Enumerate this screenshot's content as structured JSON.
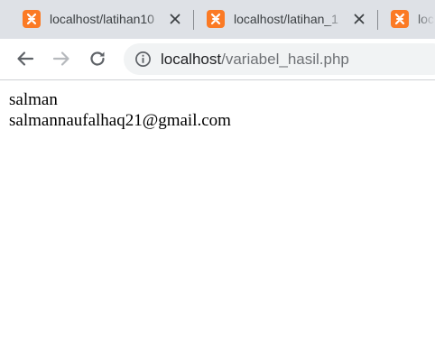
{
  "tabs": [
    {
      "title": "localhost/latihan10",
      "close_glyph": "✕",
      "active": false
    },
    {
      "title": "localhost/latihan_1",
      "close_glyph": "✕",
      "active": false
    },
    {
      "title": "loc",
      "active": false
    }
  ],
  "toolbar": {
    "back_icon": "arrow-left-icon",
    "forward_icon": "arrow-right-icon",
    "reload_icon": "reload-icon",
    "address": {
      "host": "localhost",
      "path": "/variabel_hasil.php",
      "security_icon": "info-icon"
    }
  },
  "page": {
    "lines": [
      "salman",
      "salmannaufalhaq21@gmail.com"
    ]
  },
  "colors": {
    "tabstrip_bg": "#dee1e6",
    "favicon": "#fb7a24",
    "omnibox_bg": "#f1f3f4",
    "url_path": "#6f7276"
  }
}
